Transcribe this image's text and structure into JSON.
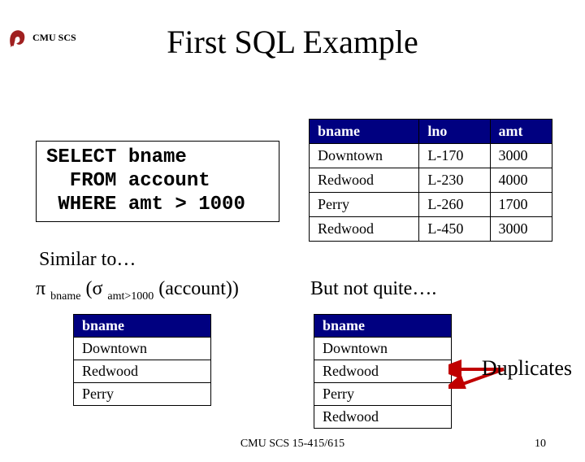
{
  "header": {
    "org": "CMU SCS"
  },
  "title": "First SQL Example",
  "sql": "SELECT bname\n  FROM account\n WHERE amt > 1000",
  "account_table": {
    "headers": [
      "bname",
      "lno",
      "amt"
    ],
    "rows": [
      [
        "Downtown",
        "L-170",
        "3000"
      ],
      [
        "Redwood",
        "L-230",
        "4000"
      ],
      [
        "Perry",
        "L-260",
        "1700"
      ],
      [
        "Redwood",
        "L-450",
        "3000"
      ]
    ]
  },
  "similar_text": "Similar to…",
  "rel_alg": {
    "pi": "π",
    "pi_sub": "bname",
    "sigma": "σ",
    "sigma_sub": "amt>1000",
    "rel": "account"
  },
  "not_quite": "But not quite….",
  "left_result": {
    "header": "bname",
    "rows": [
      "Downtown",
      "Redwood",
      "Perry"
    ]
  },
  "right_result": {
    "header": "bname",
    "rows": [
      "Downtown",
      "Redwood",
      "Perry",
      "Redwood"
    ]
  },
  "duplicates_label": "Duplicates",
  "footer": {
    "center": "CMU SCS 15-415/615",
    "page": "10"
  }
}
